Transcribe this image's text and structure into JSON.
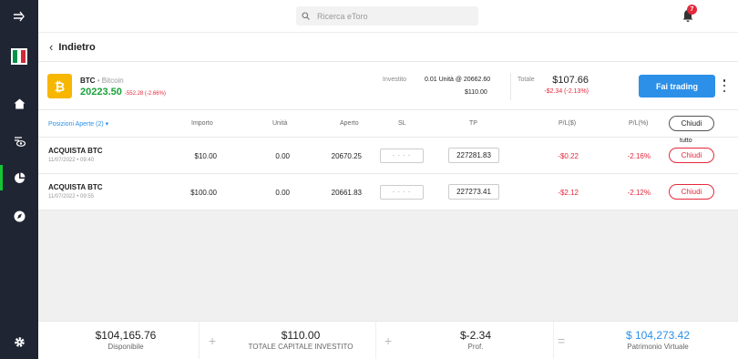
{
  "sidebar": {
    "items": [
      {
        "name": "expand",
        "icon": "expand-arrow-icon"
      },
      {
        "name": "profile",
        "icon": "italy-flag-icon"
      },
      {
        "name": "home",
        "icon": "home-icon"
      },
      {
        "name": "watchlist",
        "icon": "watchlist-eye-icon"
      },
      {
        "name": "portfolio",
        "icon": "portfolio-pie-icon",
        "active": true
      },
      {
        "name": "discover",
        "icon": "discover-compass-icon"
      },
      {
        "name": "settings",
        "icon": "gear-icon"
      }
    ]
  },
  "topbar": {
    "search_placeholder": "Ricerca eToro",
    "notifications_count": "7"
  },
  "backrow": {
    "label": "Indietro"
  },
  "instrument": {
    "symbol": "BTC",
    "separator": "•",
    "name": "Bitcoin",
    "price": "20223.50",
    "change": "-552.28 (-2.66%)",
    "invested_label": "Investito",
    "units_text": "0.01 Unità @ 20662.60",
    "invested_amount": "$110.00",
    "total_label": "Totale",
    "total_value": "$107.66",
    "total_change": "-$2.34 (-2.13%)",
    "trade_button": "Fai trading",
    "logo_letter": "₿"
  },
  "table": {
    "headers": {
      "positions": "Posizioni Aperte (2) ▾",
      "amount": "Importo",
      "units": "Unità",
      "open": "Aperto",
      "sl": "SL",
      "tp": "TP",
      "pl_usd": "P/L($)",
      "pl_pct": "P/L(%)",
      "close_all": "Chiudi",
      "close_all_sub": "tutto"
    },
    "rows": [
      {
        "action": "ACQUISTA BTC",
        "date": "11/07/2022",
        "time": "09:40",
        "amount": "$10.00",
        "units": "0.00",
        "open": "20670.25",
        "sl": "- - - -",
        "tp": "227281.83",
        "pl_usd": "-$0.22",
        "pl_pct": "-2.16%",
        "close": "Chiudi"
      },
      {
        "action": "ACQUISTA BTC",
        "date": "11/07/2022",
        "time": "09:55",
        "amount": "$100.00",
        "units": "0.00",
        "open": "20661.83",
        "sl": "- - - -",
        "tp": "227273.41",
        "pl_usd": "-$2.12",
        "pl_pct": "-2.12%",
        "close": "Chiudi"
      }
    ]
  },
  "footer": {
    "available_value": "$104,165.76",
    "available_label": "Disponibile",
    "invested_value": "$110.00",
    "invested_label": "TOTALE CAPITALE INVESTITO",
    "profit_value": "$-2.34",
    "profit_label": "Prof.",
    "equity_value": "$ 104,273.42",
    "equity_label": "Patrimonio Virtuale",
    "op_plus": "+",
    "op_equals": "="
  },
  "colors": {
    "sidebar_bg": "#1f2533",
    "accent_blue": "#2c90e8",
    "positive_green": "#1aa13a",
    "negative_red": "#e5283c",
    "btc_gold": "#f7b600"
  }
}
